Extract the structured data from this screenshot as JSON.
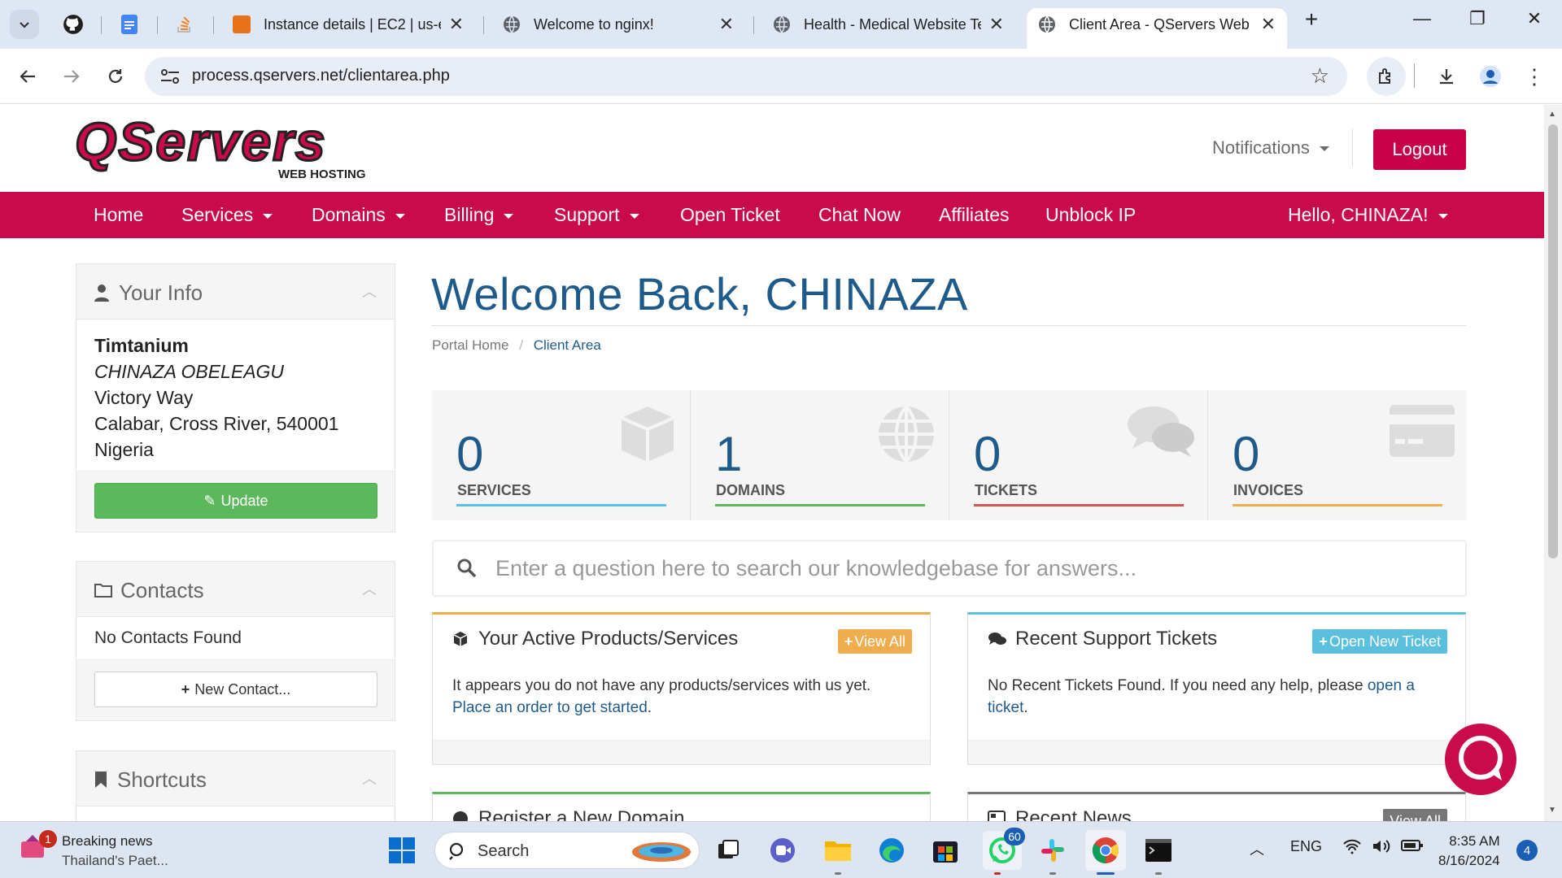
{
  "browser": {
    "tabs": [
      {
        "title": "Instance details | EC2 | us-ea",
        "favicon_color": "#e8721c"
      },
      {
        "title": "Welcome to nginx!",
        "favicon_color": "#5f6368"
      },
      {
        "title": "Health - Medical Website Te",
        "favicon_color": "#5f6368"
      },
      {
        "title": "Client Area - QServers Web",
        "favicon_color": "#5f6368"
      }
    ],
    "url": "process.qservers.net/clientarea.php"
  },
  "site": {
    "logo_text": "QServers",
    "logo_sub": "WEB HOSTING",
    "brand_color": "#c90a4b",
    "notifications": "Notifications",
    "logout": "Logout"
  },
  "nav": {
    "home": "Home",
    "services": "Services",
    "domains": "Domains",
    "billing": "Billing",
    "support": "Support",
    "open_ticket": "Open Ticket",
    "chat_now": "Chat Now",
    "affiliates": "Affiliates",
    "unblock_ip": "Unblock IP",
    "hello": "Hello, CHINAZA!"
  },
  "sidebar": {
    "your_info": {
      "title": "Your Info",
      "company": "Timtanium",
      "name": "CHINAZA OBELEAGU",
      "address1": "Victory Way",
      "address2": "Calabar, Cross River, 540001",
      "country": "Nigeria",
      "update": "Update"
    },
    "contacts": {
      "title": "Contacts",
      "empty": "No Contacts Found",
      "new": "New Contact..."
    },
    "shortcuts": {
      "title": "Shortcuts"
    }
  },
  "main": {
    "welcome": "Welcome Back, CHINAZA",
    "breadcrumb": {
      "home": "Portal Home",
      "sep": "/",
      "current": "Client Area"
    },
    "stats": [
      {
        "value": "0",
        "label": "SERVICES",
        "color": "#5bc0de"
      },
      {
        "value": "1",
        "label": "DOMAINS",
        "color": "#5cb85c"
      },
      {
        "value": "0",
        "label": "TICKETS",
        "color": "#d9534f"
      },
      {
        "value": "0",
        "label": "INVOICES",
        "color": "#f0ad4e"
      }
    ],
    "kb_placeholder": "Enter a question here to search our knowledgebase for answers...",
    "products": {
      "title": "Your Active Products/Services",
      "button": "View All",
      "text": "It appears you do not have any products/services with us yet.",
      "link": "Place an order to get started",
      "link_tail": "."
    },
    "tickets": {
      "title": "Recent Support Tickets",
      "button": "Open New Ticket",
      "text": "No Recent Tickets Found. If you need any help, please",
      "link": "open a ticket",
      "link_tail": "."
    },
    "domain_card": {
      "title": "Register a New Domain"
    },
    "news_card": {
      "title": "Recent News",
      "button": "View All"
    }
  },
  "taskbar": {
    "news_badge": "1",
    "news_title": "Breaking news",
    "news_sub": "Thailand's Paet...",
    "search": "Search",
    "whatsapp_badge": "60",
    "lang": "ENG",
    "time": "8:35 AM",
    "date": "8/16/2024",
    "notif_count": "4"
  }
}
